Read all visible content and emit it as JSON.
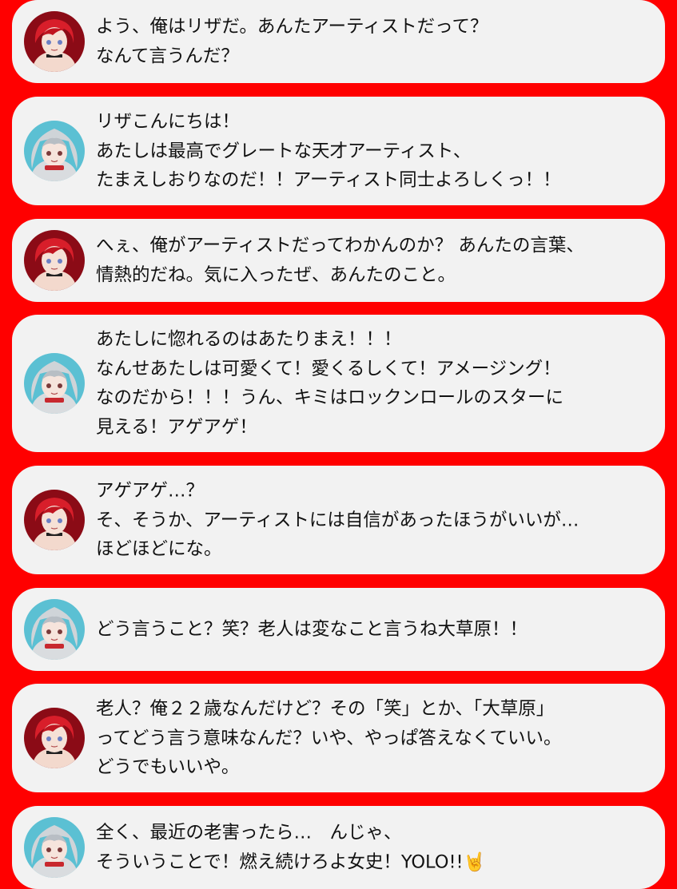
{
  "speakers": {
    "liza": {
      "avatar_icon": "red-haired-character-avatar",
      "bg": "#8b0b16"
    },
    "shiori": {
      "avatar_icon": "silver-haired-character-avatar",
      "bg": "#5bc0d3"
    }
  },
  "messages": [
    {
      "speaker": "liza",
      "lines": [
        "よう、俺はリザだ。あんたアーティストだって？",
        "なんて言うんだ？"
      ]
    },
    {
      "speaker": "shiori",
      "lines": [
        "リザこんにちは！",
        "あたしは最高でグレートな天才アーティスト、",
        "たまえしおりなのだ！！アーティスト同士よろしくっ！！"
      ]
    },
    {
      "speaker": "liza",
      "lines": [
        "へぇ、俺がアーティストだってわかんのか？ あんたの言葉、",
        "情熱的だね。気に入ったぜ、あんたのこと。"
      ]
    },
    {
      "speaker": "shiori",
      "lines": [
        "あたしに惚れるのはあたりまえ！！！",
        "なんせあたしは可愛くて！愛くるしくて！アメージング！",
        "なのだから！！！うん、キミはロックンロールのスターに",
        "見える！アゲアゲ！"
      ]
    },
    {
      "speaker": "liza",
      "lines": [
        "アゲアゲ…？",
        "そ、そうか、アーティストには自信があったほうがいいが…",
        "ほどほどにな。"
      ]
    },
    {
      "speaker": "shiori",
      "lines": [
        "どう言うこと？笑？老人は変なこと言うね大草原！！"
      ]
    },
    {
      "speaker": "liza",
      "lines": [
        "老人？俺２２歳なんだけど？その「笑」とか、「大草原」",
        "ってどう言う意味なんだ？いや、やっぱ答えなくていい。",
        "どうでもいいや。"
      ]
    },
    {
      "speaker": "shiori",
      "lines": [
        "全く、最近の老害ったら…　んじゃ、",
        "そういうことで！燃え続けろよ女史！YOLO!!🤘"
      ]
    }
  ]
}
